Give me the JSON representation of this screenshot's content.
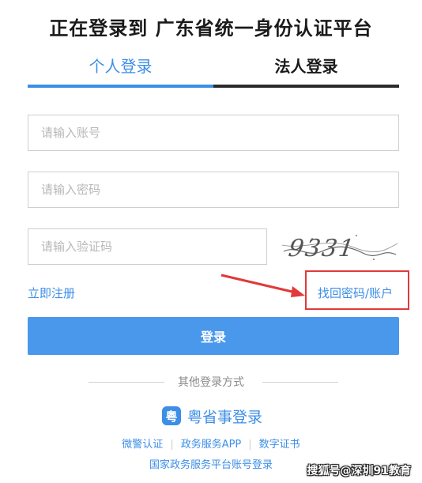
{
  "page": {
    "title": "正在登录到 广东省统一身份认证平台"
  },
  "tabs": {
    "personal": "个人登录",
    "legal": "法人登录",
    "active": "personal",
    "active_color": "#3c8ee6"
  },
  "form": {
    "account_placeholder": "请输入账号",
    "password_placeholder": "请输入密码",
    "captcha_placeholder": "请输入验证码",
    "captcha_image_text": "9331"
  },
  "links": {
    "register": "立即注册",
    "find_password": "找回密码/账户"
  },
  "login_button": "登录",
  "other_methods": {
    "label": "其他登录方式",
    "yueshengshi_icon": "yueshengshi-icon",
    "yueshengshi": "粤省事登录",
    "bottom": [
      "微警认证",
      "政务服务APP",
      "数字证书"
    ],
    "national": "国家政务服务平台账号登录"
  },
  "watermark": "搜狐号@深圳91教育",
  "colors": {
    "accent": "#3c8ee6",
    "button": "#4a98ec",
    "highlight": "#e03a3a"
  }
}
